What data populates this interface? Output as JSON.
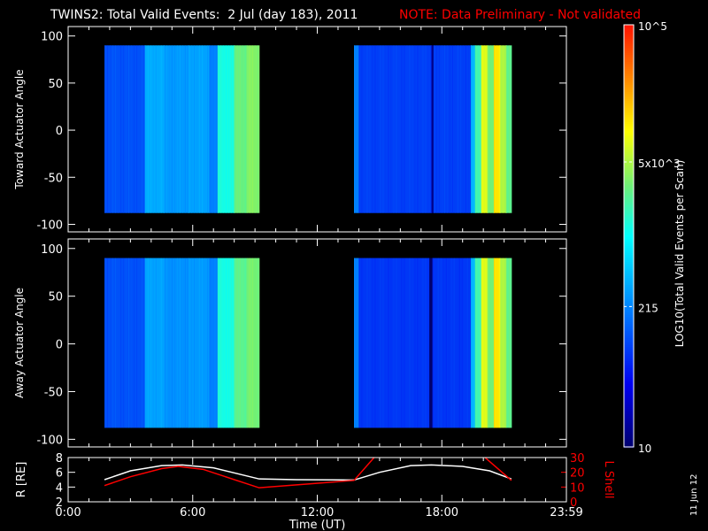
{
  "header": {
    "title": "TWINS2: Total Valid Events:  2 Jul (day 183), 2011",
    "note": "NOTE: Data Preliminary - Not validated",
    "note_color": "#ff0000"
  },
  "side_date": "11 Jun 12",
  "chart_data": [
    {
      "type": "heatmap",
      "name": "toward",
      "ylabel": "Toward Actuator Angle",
      "ylim": [
        -108,
        110
      ],
      "yticks": [
        "100",
        "50",
        "0",
        "-50",
        "-100"
      ],
      "ytick_values": [
        100,
        50,
        0,
        -50,
        -100
      ],
      "angle_range": [
        -88,
        90
      ],
      "xlim_hours": [
        0,
        24
      ],
      "blocks": [
        {
          "start": 1.75,
          "end": 9.2,
          "bands": [
            [
              1.75,
              3.7,
              2.05
            ],
            [
              3.7,
              4.6,
              2.55
            ],
            [
              4.6,
              5.8,
              2.45
            ],
            [
              5.8,
              6.8,
              2.5
            ],
            [
              6.8,
              7.2,
              2.3
            ],
            [
              7.2,
              8.0,
              3.1
            ],
            [
              8.0,
              8.6,
              3.45
            ],
            [
              8.6,
              9.2,
              3.55
            ]
          ]
        },
        {
          "start": 13.77,
          "end": 21.35,
          "bands": [
            [
              13.77,
              14.0,
              2.3
            ],
            [
              14.0,
              17.5,
              1.95
            ],
            [
              17.5,
              17.6,
              1.1
            ],
            [
              17.6,
              19.4,
              1.95
            ],
            [
              19.4,
              19.6,
              2.6
            ],
            [
              19.6,
              19.9,
              3.3
            ],
            [
              19.9,
              20.2,
              3.9
            ],
            [
              20.2,
              20.5,
              3.5
            ],
            [
              20.5,
              20.8,
              4.1
            ],
            [
              20.8,
              21.1,
              3.7
            ],
            [
              21.1,
              21.35,
              3.4
            ]
          ]
        }
      ]
    },
    {
      "type": "heatmap",
      "name": "away",
      "ylabel": "Away Actuator Angle",
      "ylim": [
        -108,
        110
      ],
      "yticks": [
        "100",
        "50",
        "0",
        "-50",
        "-100"
      ],
      "ytick_values": [
        100,
        50,
        0,
        -50,
        -100
      ],
      "angle_range": [
        -88,
        90
      ],
      "xlim_hours": [
        0,
        24
      ],
      "blocks": [
        {
          "start": 1.75,
          "end": 9.2,
          "bands": [
            [
              1.75,
              3.7,
              2.05
            ],
            [
              3.7,
              4.6,
              2.5
            ],
            [
              4.6,
              5.8,
              2.4
            ],
            [
              5.8,
              6.8,
              2.45
            ],
            [
              6.8,
              7.2,
              2.3
            ],
            [
              7.2,
              8.0,
              3.1
            ],
            [
              8.0,
              8.6,
              3.4
            ],
            [
              8.6,
              9.2,
              3.5
            ]
          ]
        },
        {
          "start": 13.77,
          "end": 21.35,
          "bands": [
            [
              13.77,
              14.0,
              2.3
            ],
            [
              14.0,
              17.4,
              1.9
            ],
            [
              17.4,
              17.55,
              1.0
            ],
            [
              17.55,
              19.4,
              1.9
            ],
            [
              19.4,
              19.6,
              2.6
            ],
            [
              19.6,
              19.9,
              3.3
            ],
            [
              19.9,
              20.2,
              3.9
            ],
            [
              20.2,
              20.5,
              3.5
            ],
            [
              20.5,
              20.8,
              4.1
            ],
            [
              20.8,
              21.1,
              3.7
            ],
            [
              21.1,
              21.35,
              3.4
            ]
          ]
        }
      ]
    },
    {
      "type": "line",
      "name": "orbit",
      "ylabel": "R [RE]",
      "y2label": "L Shell",
      "ylim": [
        2,
        8
      ],
      "y2lim": [
        0,
        30
      ],
      "yticks": [
        "8",
        "6",
        "4",
        "2"
      ],
      "ytick_values": [
        8,
        6,
        4,
        2
      ],
      "y2ticks": [
        "30",
        "20",
        "10",
        "0"
      ],
      "y2tick_values": [
        30,
        20,
        10,
        0
      ],
      "xlabel": "Time (UT)",
      "xticks": [
        "0:00",
        "6:00",
        "12:00",
        "18:00",
        "23:59"
      ],
      "xtick_values": [
        0,
        6,
        12,
        18,
        24
      ],
      "series": [
        {
          "name": "R",
          "axis": "left",
          "color": "#ffffff",
          "segments": [
            [
              [
                1.75,
                5.0
              ],
              [
                3,
                6.2
              ],
              [
                4.5,
                6.9
              ],
              [
                5.5,
                7.0
              ],
              [
                7,
                6.6
              ],
              [
                9.2,
                5.1
              ],
              [
                11,
                5.0
              ],
              [
                13.77,
                4.95
              ],
              [
                15,
                6.0
              ],
              [
                16.5,
                6.9
              ],
              [
                17.5,
                7.0
              ],
              [
                19,
                6.8
              ],
              [
                20.3,
                6.2
              ],
              [
                21.35,
                5.1
              ]
            ]
          ]
        },
        {
          "name": "L Shell",
          "axis": "right",
          "color": "#ff0000",
          "segments": [
            [
              [
                1.75,
                11
              ],
              [
                3,
                17
              ],
              [
                4.5,
                22.5
              ],
              [
                5.3,
                24
              ],
              [
                6.5,
                22
              ],
              [
                9.2,
                9.5
              ],
              [
                11,
                11.5
              ],
              [
                13.77,
                14.5
              ],
              [
                14.8,
                31
              ]
            ],
            [
              [
                20.0,
                31
              ],
              [
                21.35,
                14.5
              ]
            ]
          ]
        }
      ]
    }
  ],
  "colorbar": {
    "label": "LOG10(Total Valid Events per Scan)",
    "log_range": [
      1,
      5
    ],
    "ticks": [
      {
        "label": "10^5",
        "log": 5
      },
      {
        "label": "5x10^3",
        "log": 3.7
      },
      {
        "label": "215",
        "log": 2.33
      },
      {
        "label": "10",
        "log": 1
      }
    ]
  }
}
